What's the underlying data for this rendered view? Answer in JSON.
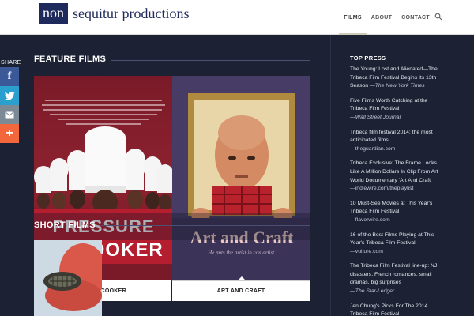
{
  "header": {
    "logo_boxed": "non",
    "logo_rest": "sequitur productions",
    "nav": [
      {
        "label": "FILMS"
      },
      {
        "label": "ABOUT"
      },
      {
        "label": "CONTACT"
      }
    ]
  },
  "share": {
    "label": "SHARE",
    "buttons": [
      {
        "icon": "facebook-icon",
        "glyph": "f"
      },
      {
        "icon": "twitter-icon",
        "glyph": ""
      },
      {
        "icon": "email-icon",
        "glyph": ""
      },
      {
        "icon": "more-icon",
        "glyph": "+"
      }
    ]
  },
  "main": {
    "feature_title": "FEATURE FILMS",
    "short_title": "SHORT FILMS",
    "films": [
      {
        "caption": "E COOKER",
        "poster_line1": "PRESSURE",
        "poster_line2": "COOKER"
      },
      {
        "caption": "ART AND CRAFT",
        "poster_title": "Art and Craft",
        "poster_tagline": "He puts the artist in con artist."
      }
    ]
  },
  "sidebar": {
    "title": "TOP PRESS",
    "items": [
      {
        "headline": "The Young: Lost and Alienated—The Tribeca Film Festival Begins Its 13th Season",
        "source": "—The New York Times",
        "italic": true
      },
      {
        "headline": "Five Films Worth Catching at the Tribeca Film Festival",
        "source": "—Wall Street Journal",
        "italic": true
      },
      {
        "headline": "Tribeca film festival 2014: the most anticipated films",
        "source": "—theguardian.com",
        "italic": false
      },
      {
        "headline": "Tribeca Exclusive: The Frame Looks Like A Million Dollars In Clip From Art World Documentary 'Art And Craft'",
        "source": "—indiewire.com/theplaylist",
        "italic": false
      },
      {
        "headline": "10 Must-See Movies at This Year's Tribeca Film Festival",
        "source": "—flavorwire.com",
        "italic": false
      },
      {
        "headline": "16 of the Best Films Playing at This Year's Tribeca Film Festival",
        "source": "—vulture.com",
        "italic": false
      },
      {
        "headline": "The Tribeca Film Festival line-up: NJ disasters, French romances, small dramas, big surprises",
        "source": "—The Star-Ledger",
        "italic": true
      },
      {
        "headline": "Jen Chung's Picks For The 2014 Tribeca Film Festival",
        "source": "",
        "italic": false
      }
    ]
  }
}
